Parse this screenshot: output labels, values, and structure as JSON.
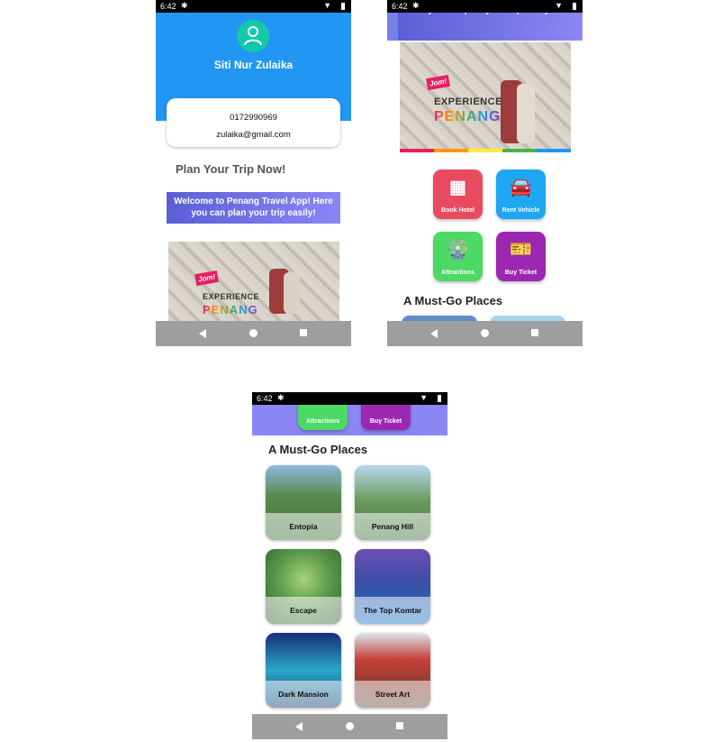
{
  "status": {
    "time": "6:42"
  },
  "profile": {
    "name": "Siti Nur Zulaika",
    "phone": "0172990969",
    "email": "zulaika@gmail.com"
  },
  "home": {
    "plan_title": "Plan Your Trip Now!",
    "welcome_line1": "Welcome to Penang Travel App! Here",
    "welcome_line2": "you can plan your trip easily!"
  },
  "banner": {
    "tag": "Jom!",
    "line1": "EXPERIENCE",
    "line2": "PENANG"
  },
  "services": [
    {
      "label": "Book Hotel",
      "icon": "hotel-icon",
      "color": "#e84a5f"
    },
    {
      "label": "Rent Vehicle",
      "icon": "car-icon",
      "color": "#1ea7f2"
    },
    {
      "label": "Attractions",
      "icon": "ferris-wheel-icon",
      "color": "#4cd964"
    },
    {
      "label": "Buy Ticket",
      "icon": "ticket-icon",
      "color": "#9c27b0"
    }
  ],
  "must_go": {
    "title": "A Must-Go Places",
    "places": [
      {
        "name": "Entopia"
      },
      {
        "name": "Penang Hill"
      },
      {
        "name": "Escape"
      },
      {
        "name": "The Top Komtar"
      },
      {
        "name": "Dark Mansion"
      },
      {
        "name": "Street Art"
      }
    ]
  },
  "colors": {
    "primary": "#2196f3",
    "gradient_start": "#5b5fd6",
    "gradient_end": "#8c86f5",
    "navbar": "#9e9e9e"
  }
}
